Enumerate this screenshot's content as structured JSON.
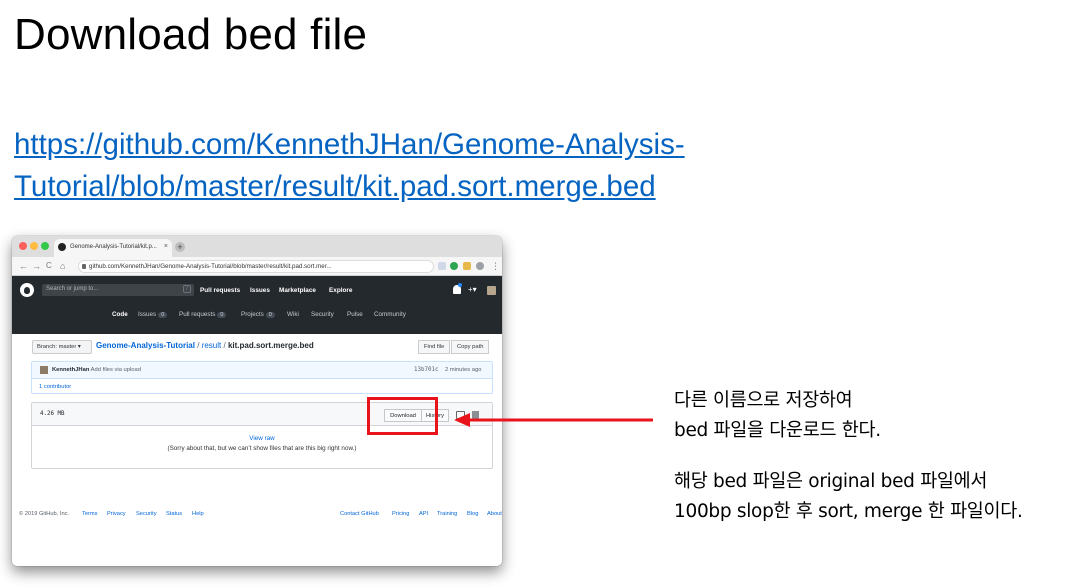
{
  "slide": {
    "title": "Download bed file",
    "link_line1": "https://github.com/KennethJHan/Genome-Analysis-",
    "link_line2": "Tutorial/blob/master/result/kit.pad.sort.merge.bed"
  },
  "browser": {
    "tab_title": "Genome-Analysis-Tutorial/kit.p...",
    "tab_close": "×",
    "new_tab": "+",
    "back": "←",
    "forward": "→",
    "reload": "C",
    "home": "⌂",
    "url": "github.com/KennethJHan/Genome-Analysis-Tutorial/blob/master/result/kit.pad.sort.mer...",
    "menu": "⋮"
  },
  "github": {
    "search_placeholder": "Search or jump to...",
    "search_shortcut": "/",
    "nav": [
      "Pull requests",
      "Issues",
      "Marketplace",
      "Explore"
    ],
    "plus": "+▾",
    "repo_tabs": {
      "code": "Code",
      "issues": "Issues",
      "issues_count": "0",
      "pulls": "Pull requests",
      "pulls_count": "0",
      "projects": "Projects",
      "projects_count": "0",
      "wiki": "Wiki",
      "security": "Security",
      "pulse": "Pulse",
      "community": "Community"
    },
    "branch": "Branch: master ▾",
    "crumb_repo": "Genome-Analysis-Tutorial",
    "crumb_sep": "/",
    "crumb_dir": "result",
    "crumb_file": "kit.pad.sort.merge.bed",
    "find_file": "Find file",
    "copy_path": "Copy path",
    "commit": {
      "author": "KennethJHan",
      "message": "Add files via upload",
      "sha": "13b701c",
      "ago": "2 minutes ago",
      "contributors": "1 contributor"
    },
    "file": {
      "size": "4.26 MB",
      "download": "Download",
      "history": "History",
      "view_raw": "View raw",
      "too_big": "(Sorry about that, but we can’t show files that are this big right now.)"
    },
    "footer": {
      "copyright": "© 2019 GitHub, Inc.",
      "left_links": [
        "Terms",
        "Privacy",
        "Security",
        "Status",
        "Help"
      ],
      "right_links": [
        "Contact GitHub",
        "Pricing",
        "API",
        "Training",
        "Blog",
        "About"
      ]
    }
  },
  "annotation": {
    "line1": "다른 이름으로 저장하여",
    "line2": "bed 파일을 다운로드 한다.",
    "line3": "해당 bed 파일은 original bed 파일에서",
    "line4": "100bp slop한 후 sort, merge 한 파일이다.",
    "highlight_color": "#e8131b"
  }
}
